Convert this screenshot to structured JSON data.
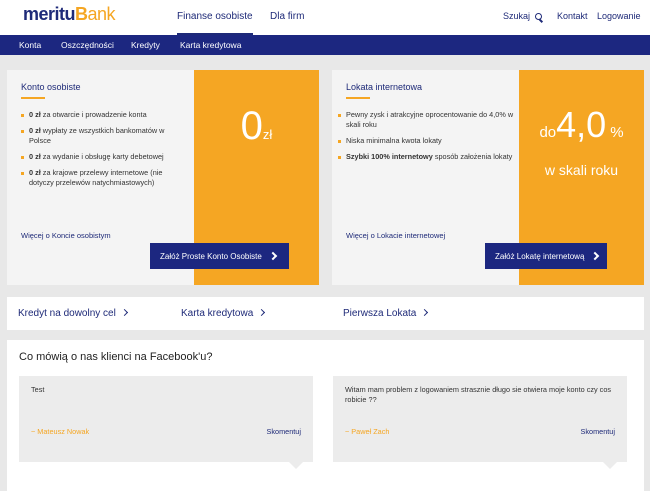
{
  "header": {
    "logo": {
      "meritu": "meritu",
      "b": "B",
      "ank": "ank"
    },
    "nav": {
      "personal": "Finanse osobiste",
      "business": "Dla firm"
    },
    "utility": {
      "search": "Szukaj",
      "contact": "Kontakt",
      "login": "Logowanie"
    }
  },
  "subnav": {
    "items": [
      "Konta",
      "Oszczędności",
      "Kredyty",
      "Karta kredytowa"
    ]
  },
  "account_card": {
    "title": "Konto osobiste",
    "bullets": [
      {
        "bold": "0 zł",
        "text": " za otwarcie i prowadzenie konta"
      },
      {
        "bold": "0 zł",
        "text": " wypłaty ze wszystkich bankomatów w Polsce"
      },
      {
        "bold": "0 zł",
        "text": " za wydanie i obsługę karty debetowej"
      },
      {
        "bold": "0 zł",
        "text": " za krajowe przelewy internetowe (nie dotyczy przelewów natychmiastowych)"
      }
    ],
    "more_link": "Więcej o Koncie osobistym",
    "price_value": "0",
    "price_unit": "zł",
    "cta": "Załóż Proste Konto Osobiste"
  },
  "deposit_card": {
    "title": "Lokata internetowa",
    "bullets": [
      {
        "bold": "",
        "text": "Pewny zysk i atrakcyjne oprocentowanie do 4,0% w skali roku"
      },
      {
        "bold": "",
        "text": "Niska minimalna kwota lokaty"
      },
      {
        "bold": "Szybki 100% internetowy",
        "text": " sposób założenia lokaty"
      }
    ],
    "more_link": "Więcej o Lokacie internetowej",
    "rate_prefix": "do",
    "rate_value": "4,0",
    "rate_unit": "%",
    "rate_suffix": "w skali roku",
    "cta": "Załóż Lokatę internetową"
  },
  "quick_links": [
    "Kredyt na dowolny cel",
    "Karta kredytowa",
    "Pierwsza Lokata"
  ],
  "facebook": {
    "title": "Co mówią o nas klienci na Facebook'u?",
    "reply_label": "Skomentuj",
    "comments": [
      {
        "text": "Test",
        "author": "~ Mateusz Nowak"
      },
      {
        "text": "Witam mam problem z logowaniem strasznie długo sie otwiera moje konto czy cos robicie ??",
        "author": "~ Paweł Zach"
      }
    ]
  },
  "colors": {
    "navy": "#1c2780",
    "orange": "#f5a623",
    "background": "#e8e8e8"
  }
}
